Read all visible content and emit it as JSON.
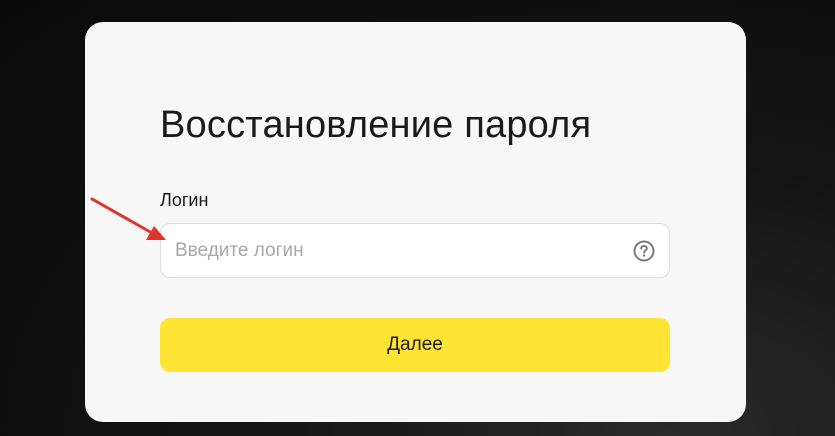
{
  "card": {
    "title": "Восстановление пароля",
    "login_label": "Логин",
    "login_placeholder": "Введите логин",
    "login_value": "",
    "help_icon": "question-circle-icon",
    "next_label": "Далее"
  },
  "colors": {
    "card_background": "#f7f7f7",
    "button_background": "#ffe433",
    "annotation_arrow": "#e0342a"
  }
}
